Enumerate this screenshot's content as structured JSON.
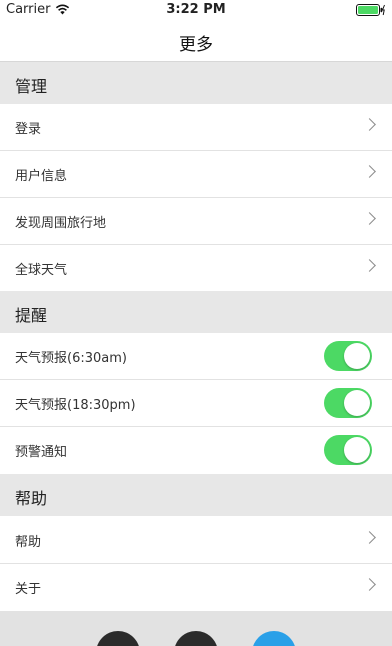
{
  "status_bar": {
    "carrier": "Carrier",
    "time": "3:22 PM",
    "wifi_icon": "wifi-icon",
    "battery_icon": "battery-icon"
  },
  "nav": {
    "title": "更多"
  },
  "sections": {
    "manage": {
      "title": "管理",
      "items": [
        "登录",
        "用户信息",
        "发现周围旅行地",
        "全球天气"
      ]
    },
    "remind": {
      "title": "提醒",
      "items": [
        {
          "label": "天气预报(6:30am)",
          "on": true
        },
        {
          "label": "天气预报(18:30pm)",
          "on": true
        },
        {
          "label": "预警通知",
          "on": true
        }
      ]
    },
    "help": {
      "title": "帮助",
      "items": [
        "帮助",
        "关于"
      ]
    }
  },
  "bottom_buttons": {
    "icons": [
      "dark-circle-icon",
      "dark-circle-icon",
      "blue-circle-icon"
    ],
    "colors": [
      "#2b2b2b",
      "#2b2b2b",
      "#2aa0e8"
    ]
  },
  "colors": {
    "toggle_on": "#4cd964",
    "section_bg": "#e7e7e7"
  }
}
